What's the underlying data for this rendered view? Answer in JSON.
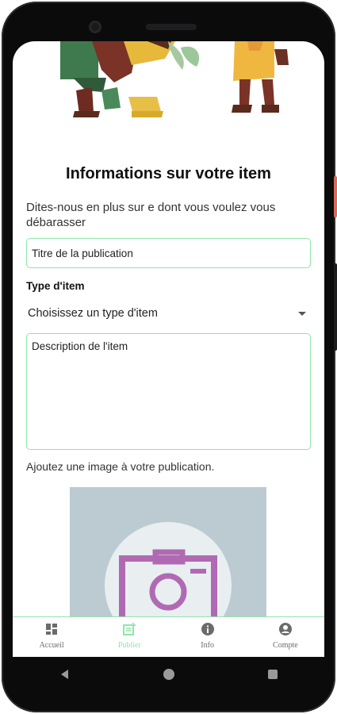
{
  "form": {
    "title": "Informations sur votre item",
    "subtitle": "Dites-nous en plus sur e dont vous voulez vous débarasser",
    "title_field_placeholder": "Titre de la publication",
    "type_label": "Type d'item",
    "type_select_value": "Choisissez un type d'item",
    "description_placeholder": "Description de l'item",
    "image_hint": "Ajoutez une image à votre publication."
  },
  "bottom_nav": {
    "items": [
      {
        "label": "Accueil",
        "icon": "dashboard-icon",
        "active": false
      },
      {
        "label": "Publier",
        "icon": "post-add-icon",
        "active": true
      },
      {
        "label": "Info",
        "icon": "info-icon",
        "active": false
      },
      {
        "label": "Compte",
        "icon": "account-icon",
        "active": false
      }
    ]
  },
  "colors": {
    "accent_green": "#8fe6a8",
    "camera_purple": "#b06ab3",
    "image_placeholder_bg": "#bccbd2"
  },
  "system_nav": [
    "back-icon",
    "home-icon",
    "recents-icon"
  ]
}
